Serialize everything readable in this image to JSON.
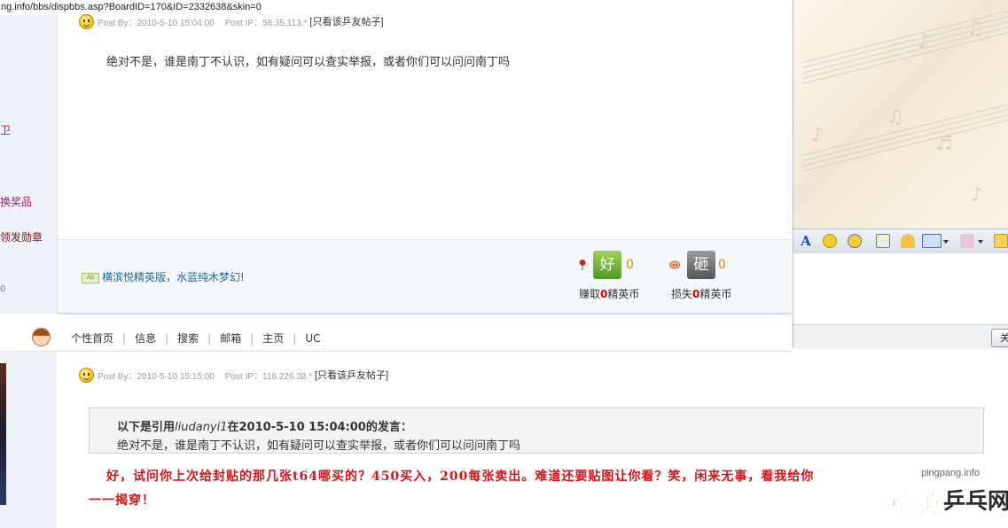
{
  "browser": {
    "url_partial": "ng.info/bbs/dispbbs.asp?BoardID=170&ID=2332638&skin=0"
  },
  "sidebar": {
    "items": [
      {
        "label": "卫",
        "color": "#d8141b"
      },
      {
        "label": "换奖品",
        "color": "#a01a6e"
      },
      {
        "label": "领发勋章",
        "color": "#7a1515"
      },
      {
        "label": "0",
        "color": "#777777"
      }
    ]
  },
  "post1": {
    "meta": {
      "post_by": "Post By：2010-5-10 15:04:00",
      "post_ip": "Post IP：58.35.113.*",
      "only_view_link": "[只看该乒友帖子]"
    },
    "content": "绝对不是，谁是南丁不认识，如有疑问可以查实举报，或者你们可以问问南丁吗",
    "signature": {
      "ad_badge": "AD",
      "text": "横滨悦精英版，水蓝纯木梦幻!"
    },
    "coins": {
      "earn": {
        "icon_text": "好",
        "count": "0",
        "caption_prefix": "赚取",
        "caption_value": "0",
        "caption_suffix": "精英币"
      },
      "lose": {
        "icon_text": "砸",
        "count": "0",
        "caption_prefix": "损失",
        "caption_value": "0",
        "caption_suffix": "精英币"
      }
    }
  },
  "user_nav": {
    "links": [
      "个性首页",
      "信息",
      "搜索",
      "邮箱",
      "主页",
      "UC"
    ],
    "separator": "|"
  },
  "post2": {
    "meta": {
      "post_by": "Post By：2010-5-10 15:15:00",
      "post_ip": "Post IP：116.226.38.*",
      "only_view_link": "[只看该乒友帖子]"
    },
    "quote": {
      "prefix": "以下是引用",
      "author": "liudanyi1",
      "suffix": "在2010-5-10 15:04:00的发言：",
      "body": "绝对不是，谁是南丁不认识，如有疑问可以查实举报，或者你们可以问问南丁吗"
    },
    "reply_line1": "好，试问你上次给封贴的那几张t64哪买的？450买入，200每张卖出。难道还要贴图让你看？笑，闲来无事，看我给你",
    "reply_line2": "一一揭穿！"
  },
  "chat_panel": {
    "toolbar_icons": [
      "font-icon",
      "smiley-icon",
      "wink-icon",
      "image-icon",
      "screenshot-icon",
      "screen-capture-icon",
      "face-icon",
      "message-icon"
    ],
    "send_label": "关"
  },
  "watermark": {
    "url": "pingpang.info",
    "brand_a": "精英",
    "brand_b": "乒乓网"
  },
  "colors": {
    "accent_red": "#d0141b",
    "coin_orange": "#e08a00",
    "link_blue": "#1a6a9a"
  }
}
